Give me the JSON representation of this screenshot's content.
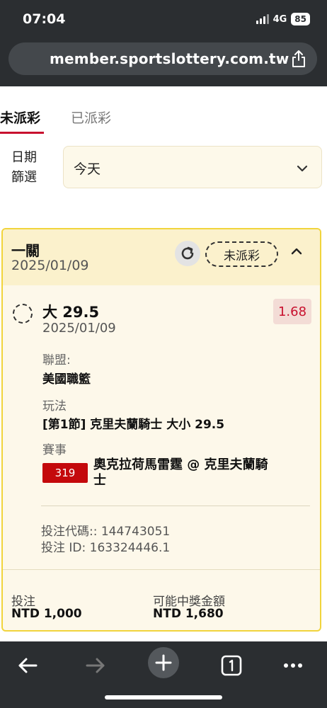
{
  "status_bar": {
    "time": "07:04",
    "network": "4G",
    "battery": "85"
  },
  "browser": {
    "url": "member.sportslottery.com.tw"
  },
  "tabs": [
    {
      "label": "未派彩",
      "active": true
    },
    {
      "label": "已派彩",
      "active": false
    }
  ],
  "filter": {
    "label": "日期\n篩選",
    "label_line1": "日期",
    "label_line2": "篩選",
    "value": "今天"
  },
  "ticket": {
    "title": "一關",
    "date": "2025/01/09",
    "status": "未派彩",
    "selection": "大 29.5",
    "selection_date": "2025/01/09",
    "odds": "1.68",
    "league_label": "聯盟:",
    "league": "美國職籃",
    "market_label": "玩法",
    "market": "[第1節] 克里夫蘭騎士 大小 29.5",
    "event_label": "賽事",
    "event_code": "319",
    "event_name": "奧克拉荷馬雷霆 @ 克里夫蘭騎士",
    "bet_code": "投注代碼:: 144743051",
    "bet_id": "投注 ID: 163324446.1",
    "stake_label": "投注",
    "stake": "NTD 1,000",
    "payout_label": "可能中獎金額",
    "payout": "NTD 1,680"
  },
  "colors": {
    "accent": "#c8102e",
    "card_border": "#f1d43c",
    "event_badge": "#c4090c"
  }
}
